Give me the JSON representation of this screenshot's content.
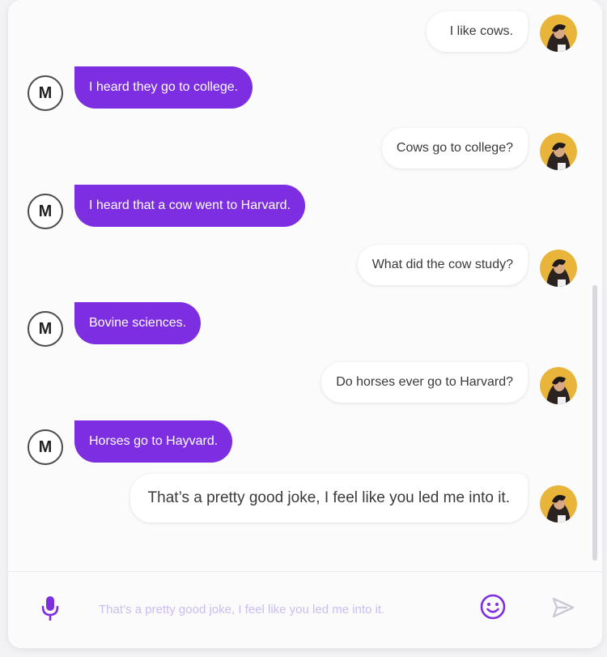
{
  "conversation": {
    "messages": [
      {
        "sender": "user",
        "text": "I like cows."
      },
      {
        "sender": "bot",
        "text": "I heard they go to college."
      },
      {
        "sender": "user",
        "text": "Cows go to college?"
      },
      {
        "sender": "bot",
        "text": "I heard that a cow went to Harvard."
      },
      {
        "sender": "user",
        "text": "What did the cow study?"
      },
      {
        "sender": "bot",
        "text": "Bovine sciences."
      },
      {
        "sender": "user",
        "text": "Do horses ever go to Harvard?"
      },
      {
        "sender": "bot",
        "text": "Horses go to Hayvard."
      },
      {
        "sender": "user",
        "text": "That’s a pretty good joke, I feel like you led me into it."
      }
    ],
    "bot_avatar_letter": "M"
  },
  "composer": {
    "placeholder": "That’s a pretty good joke, I feel like you led me into it.",
    "icons": {
      "mic": "microphone-icon",
      "emoji": "smiley-icon",
      "send": "send-icon"
    }
  },
  "colors": {
    "accent": "#7c2ee0",
    "bot_bubble_text": "#ffffff",
    "user_bubble_bg": "#ffffff",
    "send_inactive": "#c9c9d8"
  }
}
